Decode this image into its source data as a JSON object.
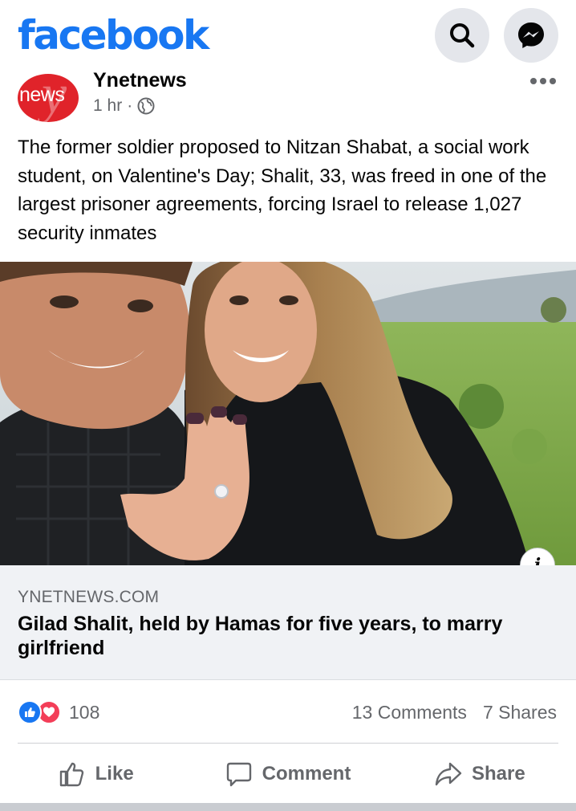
{
  "app": {
    "logo_text": "facebook",
    "brand_color": "#1877f2"
  },
  "toolbar": {
    "search_icon": "search-icon",
    "messenger_icon": "messenger-icon"
  },
  "post": {
    "page_name": "Ynetnews",
    "avatar_text": "news",
    "time": "1 hr",
    "separator": "·",
    "privacy_icon": "globe-icon",
    "text": "The former soldier proposed to Nitzan Shabat, a social work student, on Valentine's Day; Shalit, 33, was freed in one of the largest prisoner agreements, forcing Israel to release 1,027 security inmates",
    "photo_subject": "couple selfie showing engagement ring outdoors"
  },
  "link": {
    "domain": "YNETNEWS.COM",
    "title": "Gilad Shalit, held by Hamas for five years, to marry girlfriend",
    "info_label": "i"
  },
  "stats": {
    "reaction_count": "108",
    "comments": "13 Comments",
    "shares": "7 Shares",
    "like_color": "#1877f2",
    "love_color": "#f33e58"
  },
  "actions": {
    "like": "Like",
    "comment": "Comment",
    "share": "Share"
  }
}
